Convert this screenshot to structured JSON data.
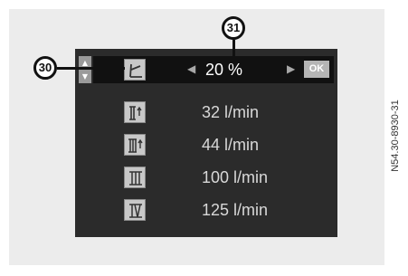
{
  "header": {
    "value": "20 %",
    "ok_label": "OK",
    "scroll_up": "▲",
    "scroll_down": "▼",
    "arrow_left": "◀",
    "arrow_right": "▶",
    "icon": "tilt-angle-icon"
  },
  "rows": [
    {
      "icon": "fan-speed-1-plus-icon",
      "value": "32 l/min"
    },
    {
      "icon": "fan-speed-2-plus-icon",
      "value": "44 l/min"
    },
    {
      "icon": "fan-speed-3-icon",
      "value": "100 l/min"
    },
    {
      "icon": "fan-speed-4-icon",
      "value": "125 l/min"
    }
  ],
  "callouts": {
    "c30": "30",
    "c31": "31"
  },
  "side_code": "N54.30-8930-31",
  "colors": {
    "screen": "#2b2b2b",
    "header": "#111111",
    "ok": "#b5b5b5"
  }
}
